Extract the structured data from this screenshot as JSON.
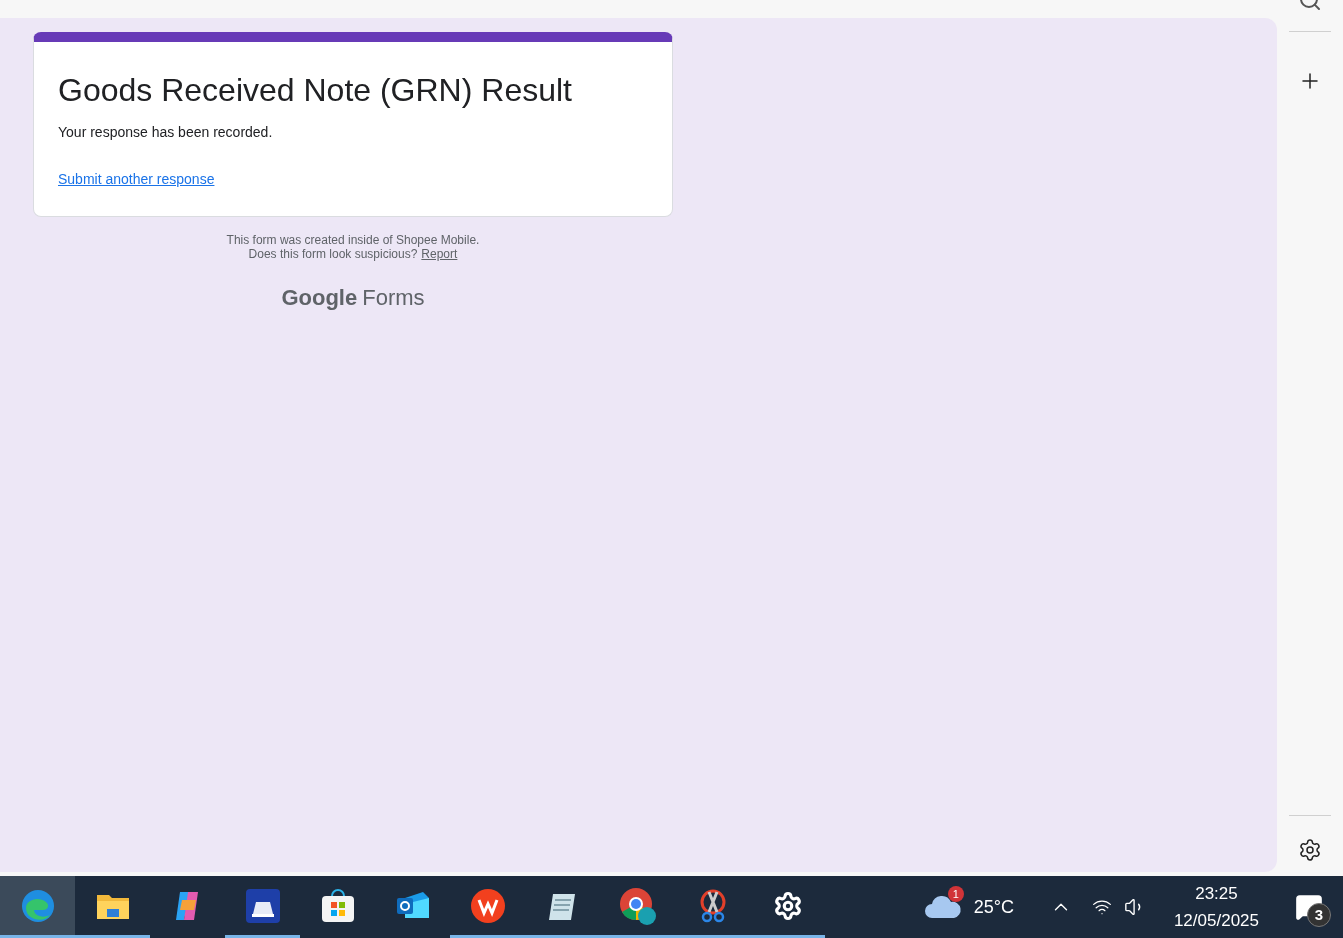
{
  "form": {
    "title": "Goods Received Note (GRN) Result",
    "message": "Your response has been recorded.",
    "link": "Submit another response"
  },
  "footer": {
    "line_1": "This form was created inside of Shopee Mobile.",
    "line_2": "Does this form look suspicious?",
    "report_link": "Report",
    "brand_1": "Google",
    "brand_2": "Forms"
  },
  "taskbar": {
    "apps": [
      {
        "kind": "edge",
        "selected": true,
        "running": true
      },
      {
        "kind": "folder",
        "selected": false,
        "running": true
      },
      {
        "kind": "copilot",
        "selected": false,
        "running": false
      },
      {
        "kind": "scanner",
        "selected": false,
        "running": true
      },
      {
        "kind": "store",
        "selected": false,
        "running": false
      },
      {
        "kind": "outlook",
        "selected": false,
        "running": false
      },
      {
        "kind": "wps",
        "selected": false,
        "running": true
      },
      {
        "kind": "notepad",
        "selected": false,
        "running": true
      },
      {
        "kind": "chrome",
        "selected": false,
        "running": true
      },
      {
        "kind": "snip",
        "selected": false,
        "running": true
      },
      {
        "kind": "settings",
        "selected": false,
        "running": true
      }
    ],
    "weather_badge": "1",
    "temperature": "25°C",
    "time": "23:25",
    "date": "12/05/2025",
    "notification_count": "3"
  }
}
